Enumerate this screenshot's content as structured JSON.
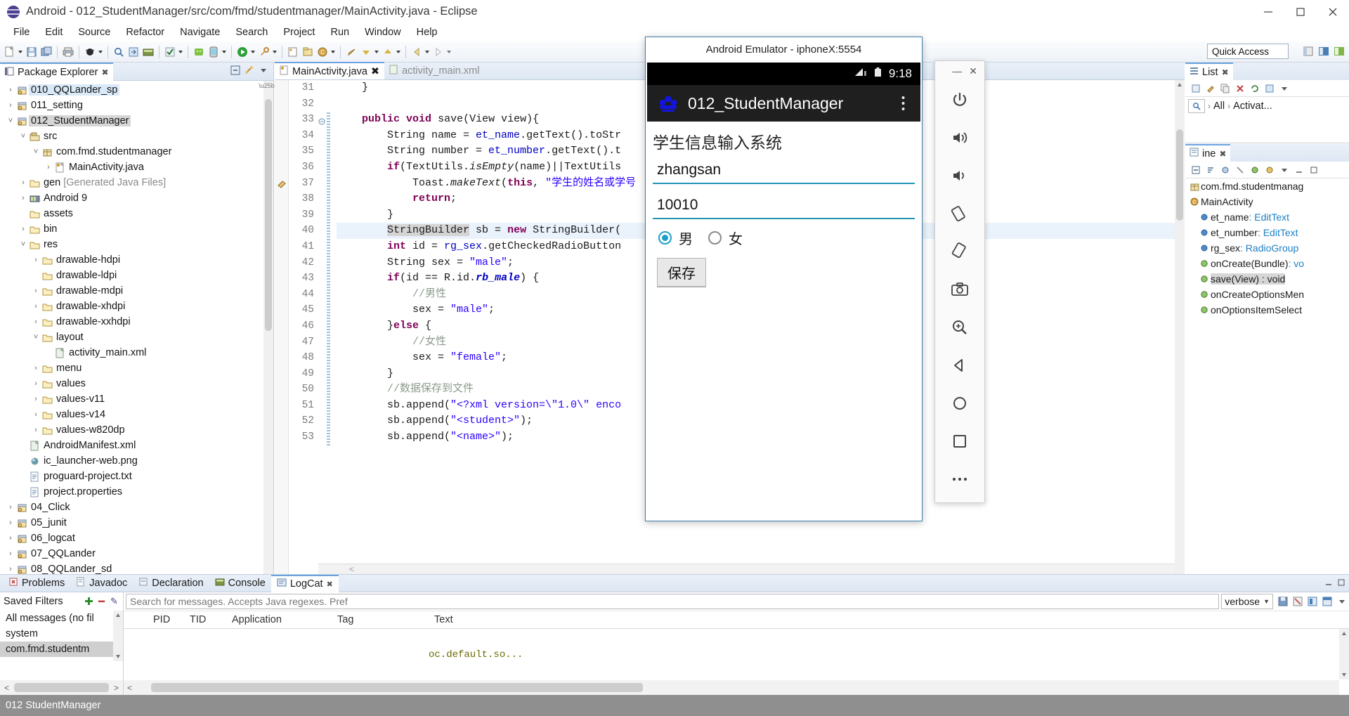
{
  "window": {
    "title": "Android - 012_StudentManager/src/com/fmd/studentmanager/MainActivity.java - Eclipse",
    "minimize": "—",
    "maximize": "❐",
    "close": "✕"
  },
  "menubar": [
    "File",
    "Edit",
    "Source",
    "Refactor",
    "Navigate",
    "Search",
    "Project",
    "Run",
    "Window",
    "Help"
  ],
  "toolbar": {
    "quick_access": "Quick Access"
  },
  "package_explorer": {
    "tab_label": "Package Explorer",
    "close": "✖",
    "tree": [
      {
        "label": "010_QQLander_sp",
        "indent": 0,
        "arrow": "›",
        "icon": "project-icon",
        "state": "sel-light"
      },
      {
        "label": "011_setting",
        "indent": 0,
        "arrow": "›",
        "icon": "project-icon",
        "state": ""
      },
      {
        "label": "012_StudentManager",
        "indent": 0,
        "arrow": "˅",
        "icon": "project-icon",
        "state": "sel-strong"
      },
      {
        "label": "src",
        "indent": 1,
        "arrow": "˅",
        "icon": "source-folder-icon",
        "state": ""
      },
      {
        "label": "com.fmd.studentmanager",
        "indent": 2,
        "arrow": "˅",
        "icon": "package-icon",
        "state": ""
      },
      {
        "label": "MainActivity.java",
        "indent": 3,
        "arrow": "›",
        "icon": "java-file-icon",
        "state": ""
      },
      {
        "label": "gen",
        "suffix": " [Generated Java Files]",
        "indent": 1,
        "arrow": "›",
        "icon": "folder-icon",
        "state": ""
      },
      {
        "label": "Android 9",
        "indent": 1,
        "arrow": "›",
        "icon": "library-icon",
        "state": ""
      },
      {
        "label": "assets",
        "indent": 1,
        "arrow": "",
        "icon": "folder-icon",
        "state": ""
      },
      {
        "label": "bin",
        "indent": 1,
        "arrow": "›",
        "icon": "folder-icon",
        "state": ""
      },
      {
        "label": "res",
        "indent": 1,
        "arrow": "˅",
        "icon": "folder-icon",
        "state": ""
      },
      {
        "label": "drawable-hdpi",
        "indent": 2,
        "arrow": "›",
        "icon": "folder-icon",
        "state": ""
      },
      {
        "label": "drawable-ldpi",
        "indent": 2,
        "arrow": "",
        "icon": "folder-icon",
        "state": ""
      },
      {
        "label": "drawable-mdpi",
        "indent": 2,
        "arrow": "›",
        "icon": "folder-icon",
        "state": ""
      },
      {
        "label": "drawable-xhdpi",
        "indent": 2,
        "arrow": "›",
        "icon": "folder-icon",
        "state": ""
      },
      {
        "label": "drawable-xxhdpi",
        "indent": 2,
        "arrow": "›",
        "icon": "folder-icon",
        "state": ""
      },
      {
        "label": "layout",
        "indent": 2,
        "arrow": "˅",
        "icon": "folder-icon",
        "state": ""
      },
      {
        "label": "activity_main.xml",
        "indent": 3,
        "arrow": "",
        "icon": "xml-file-icon",
        "state": ""
      },
      {
        "label": "menu",
        "indent": 2,
        "arrow": "›",
        "icon": "folder-icon",
        "state": ""
      },
      {
        "label": "values",
        "indent": 2,
        "arrow": "›",
        "icon": "folder-icon",
        "state": ""
      },
      {
        "label": "values-v11",
        "indent": 2,
        "arrow": "›",
        "icon": "folder-icon",
        "state": ""
      },
      {
        "label": "values-v14",
        "indent": 2,
        "arrow": "›",
        "icon": "folder-icon",
        "state": ""
      },
      {
        "label": "values-w820dp",
        "indent": 2,
        "arrow": "›",
        "icon": "folder-icon",
        "state": ""
      },
      {
        "label": "AndroidManifest.xml",
        "indent": 1,
        "arrow": "",
        "icon": "xml-file-icon",
        "state": ""
      },
      {
        "label": "ic_launcher-web.png",
        "indent": 1,
        "arrow": "",
        "icon": "image-file-icon",
        "state": ""
      },
      {
        "label": "proguard-project.txt",
        "indent": 1,
        "arrow": "",
        "icon": "text-file-icon",
        "state": ""
      },
      {
        "label": "project.properties",
        "indent": 1,
        "arrow": "",
        "icon": "text-file-icon",
        "state": ""
      },
      {
        "label": "04_Click",
        "indent": 0,
        "arrow": "›",
        "icon": "project-icon",
        "state": ""
      },
      {
        "label": "05_junit",
        "indent": 0,
        "arrow": "›",
        "icon": "project-icon",
        "state": ""
      },
      {
        "label": "06_logcat",
        "indent": 0,
        "arrow": "›",
        "icon": "project-icon",
        "state": ""
      },
      {
        "label": "07_QQLander",
        "indent": 0,
        "arrow": "›",
        "icon": "project-icon",
        "state": ""
      },
      {
        "label": "08_QQLander_sd",
        "indent": 0,
        "arrow": "›",
        "icon": "project-icon",
        "state": ""
      }
    ]
  },
  "editor": {
    "tabs": [
      {
        "label": "MainActivity.java",
        "active": true,
        "close": "✖",
        "icon": "java-file-icon"
      },
      {
        "label": "activity_main.xml",
        "active": false,
        "close": "",
        "icon": "xml-file-icon"
      }
    ],
    "first_line": 31,
    "highlighted_line": 40,
    "lines": [
      {
        "n": 31,
        "html": "    }"
      },
      {
        "n": 32,
        "html": ""
      },
      {
        "n": 33,
        "html": "    <span class=\"kw\">public</span> <span class=\"kw\">void</span> save(View view){",
        "fold": true
      },
      {
        "n": 34,
        "html": "        String name = <span class=\"fld\">et_name</span>.getText().toStr"
      },
      {
        "n": 35,
        "html": "        String number = <span class=\"fld\">et_number</span>.getText().t"
      },
      {
        "n": 36,
        "html": "        <span class=\"kw\">if</span>(TextUtils.<span class=\"stat\">isEmpty</span>(name)||TextUtils"
      },
      {
        "n": 37,
        "html": "            Toast.<span class=\"stat\">makeText</span>(<span class=\"kw\">this</span>, <span class=\"str\">\"学生的姓名或学号</span>",
        "marker": true
      },
      {
        "n": 38,
        "html": "            <span class=\"kw\">return</span>;"
      },
      {
        "n": 39,
        "html": "        }"
      },
      {
        "n": 40,
        "html": "        <span class=\"occ\">StringBuilder</span> sb = <span class=\"kw\">new</span> StringBuilder("
      },
      {
        "n": 41,
        "html": "        <span class=\"kw\">int</span> id = <span class=\"fld\">rg_sex</span>.getCheckedRadioButton"
      },
      {
        "n": 42,
        "html": "        String sex = <span class=\"str\">\"male\"</span>;"
      },
      {
        "n": 43,
        "html": "        <span class=\"kw\">if</span>(id == R.id.<span class=\"fld stat\"><b>rb_male</b></span>) {"
      },
      {
        "n": 44,
        "html": "            <span class=\"cmt\">//男性</span>"
      },
      {
        "n": 45,
        "html": "            sex = <span class=\"str\">\"male\"</span>;"
      },
      {
        "n": 46,
        "html": "        }<span class=\"kw\">else</span> {"
      },
      {
        "n": 47,
        "html": "            <span class=\"cmt\">//女性</span>"
      },
      {
        "n": 48,
        "html": "            sex = <span class=\"str\">\"female\"</span>;"
      },
      {
        "n": 49,
        "html": "        }"
      },
      {
        "n": 50,
        "html": "        <span class=\"cmt\">//数据保存到文件</span>"
      },
      {
        "n": 51,
        "html": "        sb.append(<span class=\"str\">\"&lt;?xml version=\\\"1.0\\\" enco</span>"
      },
      {
        "n": 52,
        "html": "        sb.append(<span class=\"str\">\"&lt;student&gt;\"</span>);"
      },
      {
        "n": 53,
        "html": "        sb.append(<span class=\"str\">\"&lt;name&gt;\"</span>);"
      }
    ]
  },
  "bottom_panel": {
    "tabs": [
      {
        "label": "Problems",
        "active": false,
        "icon": "problems-icon",
        "close": ""
      },
      {
        "label": "Javadoc",
        "active": false,
        "icon": "javadoc-icon",
        "close": ""
      },
      {
        "label": "Declaration",
        "active": false,
        "icon": "declaration-icon",
        "close": ""
      },
      {
        "label": "Console",
        "active": false,
        "icon": "console-icon",
        "close": ""
      },
      {
        "label": "LogCat",
        "active": true,
        "icon": "logcat-icon",
        "close": "✖"
      }
    ],
    "filters": {
      "title": "Saved Filters",
      "add": "✚",
      "remove": "━",
      "edit": "✎",
      "items": [
        {
          "label": "All messages (no fil",
          "selected": false
        },
        {
          "label": "system",
          "selected": false
        },
        {
          "label": "com.fmd.studentm",
          "selected": true
        }
      ]
    },
    "search_placeholder": "Search for messages. Accepts Java regexes. Pref",
    "verbose_level": "verbose",
    "columns": [
      "PID",
      "TID",
      "Application",
      "Tag",
      "Text"
    ],
    "rows": [
      {
        "pid": "",
        "tid": "",
        "application": "",
        "tag": "",
        "text": "oc.default.so..."
      }
    ]
  },
  "right_panels": {
    "top_tab": "List",
    "top_tab_close": "✖",
    "filter_all": "All",
    "filter_activate": "Activat...",
    "outline_tab": "ine",
    "outline_tab_close": "✖",
    "outline": [
      {
        "label": "com.fmd.studentmanag",
        "icon": "package-icon",
        "indent": 0,
        "selected": false
      },
      {
        "label": "MainActivity",
        "icon": "class-icon",
        "indent": 0,
        "selected": false
      },
      {
        "label": "et_name",
        "type": " : EditText",
        "icon": "field-icon",
        "indent": 1,
        "selected": false
      },
      {
        "label": "et_number",
        "type": " : EditText",
        "icon": "field-icon",
        "indent": 1,
        "selected": false
      },
      {
        "label": "rg_sex",
        "type": " : RadioGroup",
        "icon": "field-icon",
        "indent": 1,
        "selected": false
      },
      {
        "label": "onCreate(Bundle)",
        "type": " : vo",
        "icon": "method-icon",
        "indent": 1,
        "selected": false
      },
      {
        "label": "save(View) : void",
        "type": "",
        "icon": "method-icon",
        "indent": 1,
        "selected": true
      },
      {
        "label": "onCreateOptionsMen",
        "type": "",
        "icon": "method-icon",
        "indent": 1,
        "selected": false
      },
      {
        "label": "onOptionsItemSelect",
        "type": "",
        "icon": "method-icon",
        "indent": 1,
        "selected": false
      }
    ]
  },
  "statusbar": {
    "text": "012 StudentManager"
  },
  "emulator": {
    "window_title": "Android Emulator - iphoneX:5554",
    "status_time": "9:18",
    "app_title": "012_StudentManager",
    "overflow": "⋮",
    "heading": "学生信息输入系统",
    "name_value": "zhangsan",
    "number_value": "10010",
    "radio_male": "男",
    "radio_female": "女",
    "male_selected": true,
    "save_label": "保存"
  },
  "emulator_toolbar": {
    "minimize": "—",
    "close": "✕",
    "buttons": [
      "power-icon",
      "volume-up-icon",
      "volume-down-icon",
      "rotate-left-icon",
      "rotate-right-icon",
      "screenshot-icon",
      "zoom-icon",
      "back-icon",
      "home-icon",
      "overview-icon",
      "more-icon"
    ]
  }
}
